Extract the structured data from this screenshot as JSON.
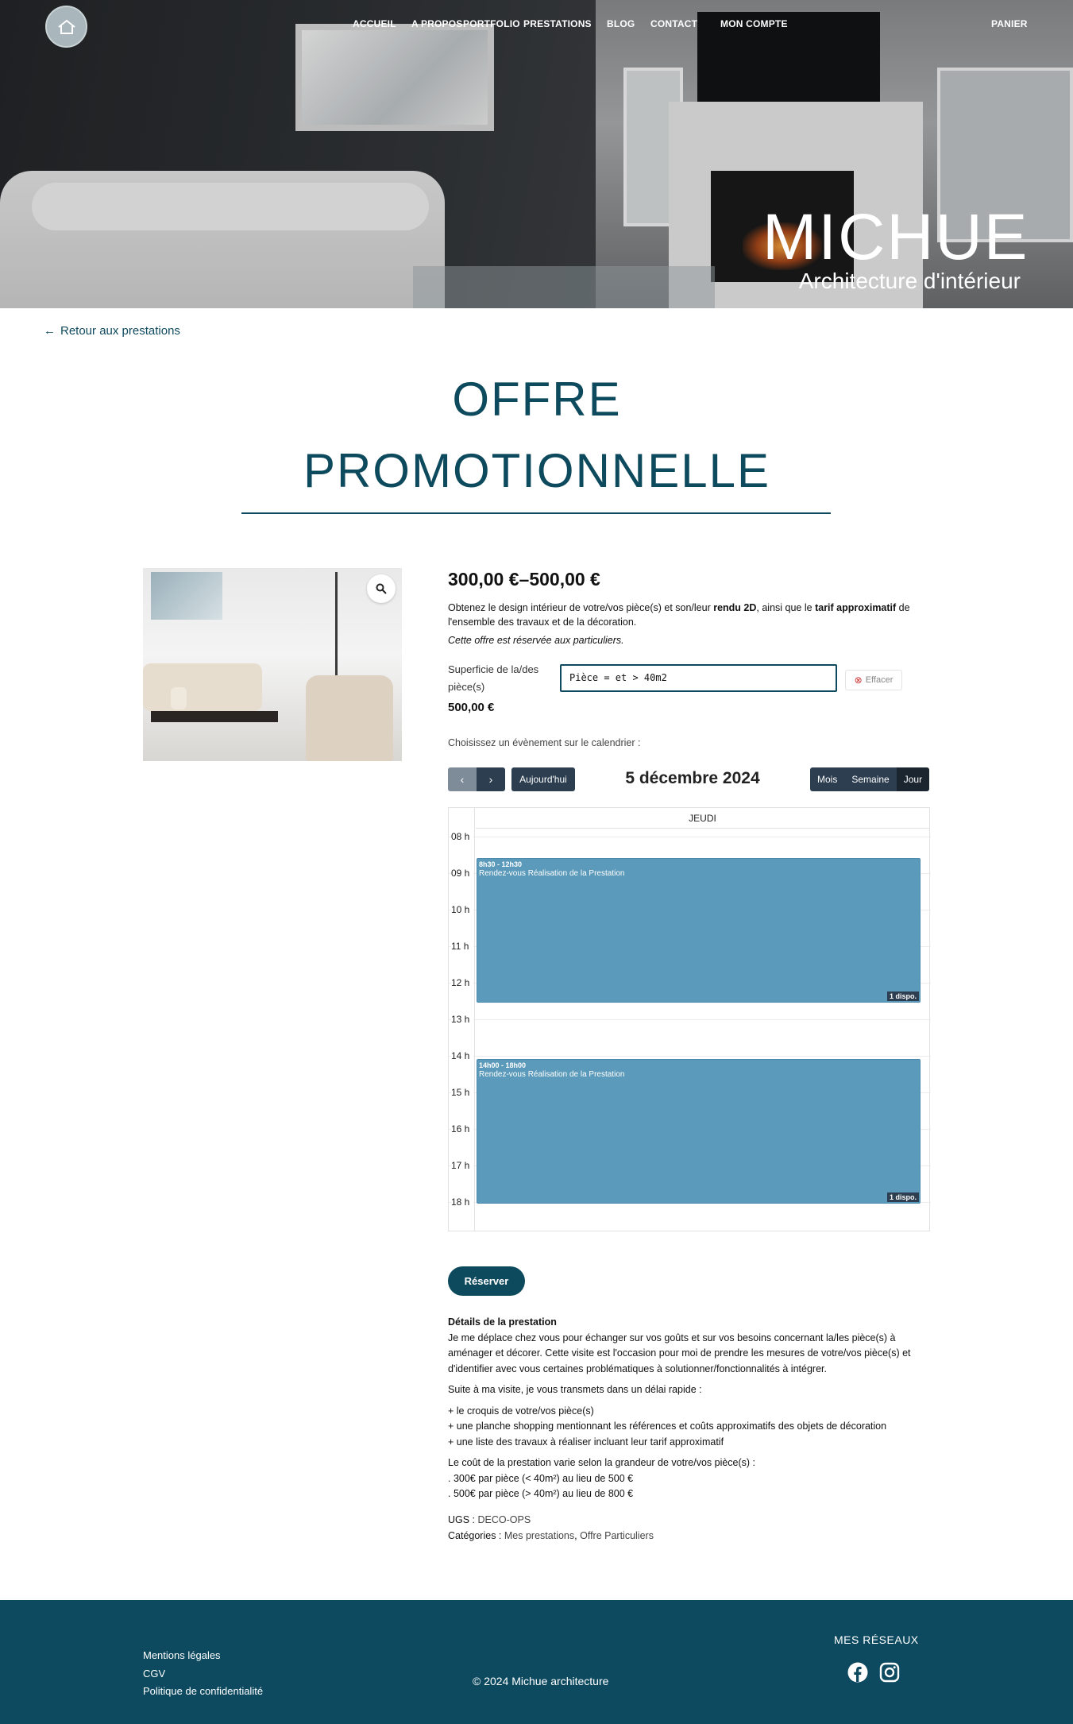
{
  "header": {
    "logo_icon": "home-logo-icon",
    "nav": [
      {
        "label": "ACCUEIL"
      },
      {
        "label": "A PROPOS"
      },
      {
        "label": "PORTFOLIO"
      },
      {
        "label": "PRESTATIONS"
      },
      {
        "label": "BLOG"
      },
      {
        "label": "CONTACT"
      },
      {
        "label": "MON COMPTE"
      },
      {
        "label": "PANIER"
      }
    ],
    "brand_title": "MICHUE",
    "brand_subtitle": "Architecture d'intérieur"
  },
  "back_link": "Retour aux prestations",
  "page_title_line1": "OFFRE",
  "page_title_line2": "PROMOTIONNELLE",
  "product": {
    "price_range": "300,00 €–500,00 €",
    "desc_part1": "Obtenez le design intérieur de votre/vos pièce(s) et son/leur ",
    "desc_bold1": "rendu 2D",
    "desc_part2": ", ainsi que le ",
    "desc_bold2": "tarif approximatif",
    "desc_part3": " de l'ensemble des travaux et de la décoration.",
    "note": "Cette offre est réservée aux particuliers.",
    "variation_label": "Superficie de la/des pièce(s)",
    "variation_value": "Pièce = et > 40m2",
    "clear_label": "Effacer",
    "variation_price": "500,00 €"
  },
  "calendar": {
    "intro": "Choisissez un évènement sur le calendrier :",
    "today_label": "Aujourd'hui",
    "date_title": "5 décembre 2024",
    "views": [
      "Mois",
      "Semaine",
      "Jour"
    ],
    "active_view": "Jour",
    "day_header": "JEUDI",
    "hours": [
      "08 h",
      "09 h",
      "10 h",
      "11 h",
      "12 h",
      "13 h",
      "14 h",
      "15 h",
      "16 h",
      "17 h",
      "18 h"
    ],
    "events": [
      {
        "time": "8h30 - 12h30",
        "title": "Rendez-vous Réalisation de la Prestation",
        "availability": "1 dispo.",
        "start": 8.5,
        "end": 12.5
      },
      {
        "time": "14h00 - 18h00",
        "title": "Rendez-vous Réalisation de la Prestation",
        "availability": "1 dispo.",
        "start": 14,
        "end": 18
      }
    ],
    "event_color": "#5b9aba"
  },
  "reserve_label": "Réserver",
  "details": {
    "heading": "Détails de la prestation",
    "p1": "Je me déplace chez vous pour échanger sur vos goûts et sur vos besoins concernant la/les pièce(s) à aménager et décorer. Cette visite est l'occasion pour moi de prendre les mesures de votre/vos pièce(s) et d'identifier avec vous certaines problématiques à solutionner/fonctionnalités à intégrer.",
    "p2": "Suite à ma visite, je vous transmets dans un délai rapide :",
    "list": [
      "+ le croquis de votre/vos pièce(s)",
      "+ une planche shopping mentionnant les références et coûts approximatifs des objets de décoration",
      "+ une liste des travaux à réaliser incluant leur tarif approximatif"
    ],
    "p3": "Le coût de la prestation varie selon la grandeur de votre/vos pièce(s) :",
    "prices": [
      ". 300€ par pièce (< 40m²) au lieu de 500 €",
      ". 500€ par pièce (> 40m²) au lieu de 800 €"
    ]
  },
  "meta": {
    "ugs_label": "UGS :",
    "ugs_value": "DECO-OPS",
    "cat_label": "Catégories :",
    "cat_1": "Mes prestations",
    "cat_sep": ",",
    "cat_2": "Offre Particuliers"
  },
  "footer": {
    "links": [
      "Mentions légales",
      "CGV",
      "Politique de confidentialité"
    ],
    "copyright": "© 2024 Michue architecture",
    "reseaux": "MES RÉSEAUX",
    "social": [
      "facebook-icon",
      "instagram-icon"
    ],
    "bg_color": "#0d4a60"
  },
  "accent_color": "#0e4a5d"
}
